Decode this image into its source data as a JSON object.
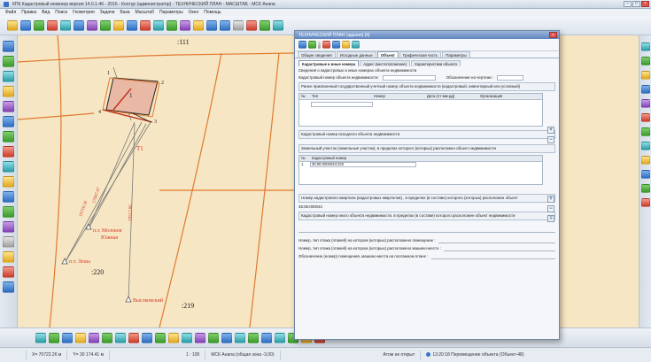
{
  "app": {
    "title": "КПК Кадастровый инженер версия 14.0.1-46 - 2016 - Контур (администратор) - ТЕХНИЧЕСКИЙ ПЛАН - МАСШТАБ - МСК Анапа",
    "menu": [
      "Файл",
      "Правка",
      "Вид",
      "Поиск",
      "Геометрия",
      "Задачи",
      "База",
      "Масштаб",
      "Параметры",
      "Окно",
      "Помощь"
    ]
  },
  "map": {
    "labels": {
      "block_111": ":111",
      "block_220": ":220",
      "block_219": ":219",
      "t1": "Т1",
      "pt_moloko": "п.т. Молоков\nЮжная",
      "pt_lesha": "п.т. Леша",
      "pt_vysokoe": "Высоковский",
      "num_1": "1",
      "num_2": "2",
      "num_3": "3",
      "num_4": "4",
      "num_1b": "1",
      "dist1": "19718.36",
      "dist2": "17807.07",
      "dist3": "19517.06"
    },
    "colors": {
      "background": "#f7e6c3",
      "lines": "#e07a30",
      "labels": "#d23a2a",
      "parcel_fill": "#e9b9a6"
    }
  },
  "dialog": {
    "title": "ТЕХНИЧЕСКИЙ ПЛАН (здания) [4]",
    "tabs": [
      "Общие сведения",
      "Исходные данные",
      "Объект",
      "Графическая часть",
      "Параметры"
    ],
    "active_tab": "Объект",
    "subtabs": [
      "Кадастровые и иные номера",
      "Адрес (местоположение)",
      "Характеристики объекта"
    ],
    "sec_title": "Сведения о кадастровых и иных номерах объекта  недвижимости",
    "cad_num_label": "Кадастровый номер объекта недвижимости:",
    "plan_label": "Обозначение на чертеже :",
    "prev_num_title": "Ранее присвоенный государственный учетный номер объекта недвижимости (кадастровый, инвентарный или условный)",
    "prev_cols": [
      "№",
      "Тип",
      "Номер",
      "Дата (ггг-мм-дд)",
      "Организация"
    ],
    "parent_label": "Кадастровый номер исходного объекта недвижимости",
    "land_title": "Земельный участок (земельные участки), в пределах которого (которых) расположен объект недвижимости",
    "land_cols": [
      "№",
      "Кадастровый номер"
    ],
    "land_rows": [
      {
        "n": "1",
        "num": "35:05:0000043:220"
      }
    ],
    "quarter_label": "Номер кадастрового квартала (кадастровых кварталов) , в пределах (в составе) которого (которых) расположен объект",
    "quarter_value": "35:05:000043",
    "other_label": "Кадастровый номер иного объекта недвижимости, в пределах (в составе) которого расположен объект недвижимости",
    "floor_label": "Номер, тип этажа (этажей) на котором (которых) расположено помещение :",
    "parking_label": "Номер, тип этажа (этажей) на котором (которых) расположено машино-место :",
    "room_label": "Обозначение (номер) помещения, машино-места на поэтажном плане :"
  },
  "status": {
    "x": "X=  70722.26 м",
    "y": "Y=  30 174.41 м",
    "scale": "1 : 100",
    "crs": "МСК Анапа  (общая зона -3,00)",
    "snap": "Атом не открыт",
    "object": "13:20:18  Перемещение объекта (Объект-48)"
  }
}
